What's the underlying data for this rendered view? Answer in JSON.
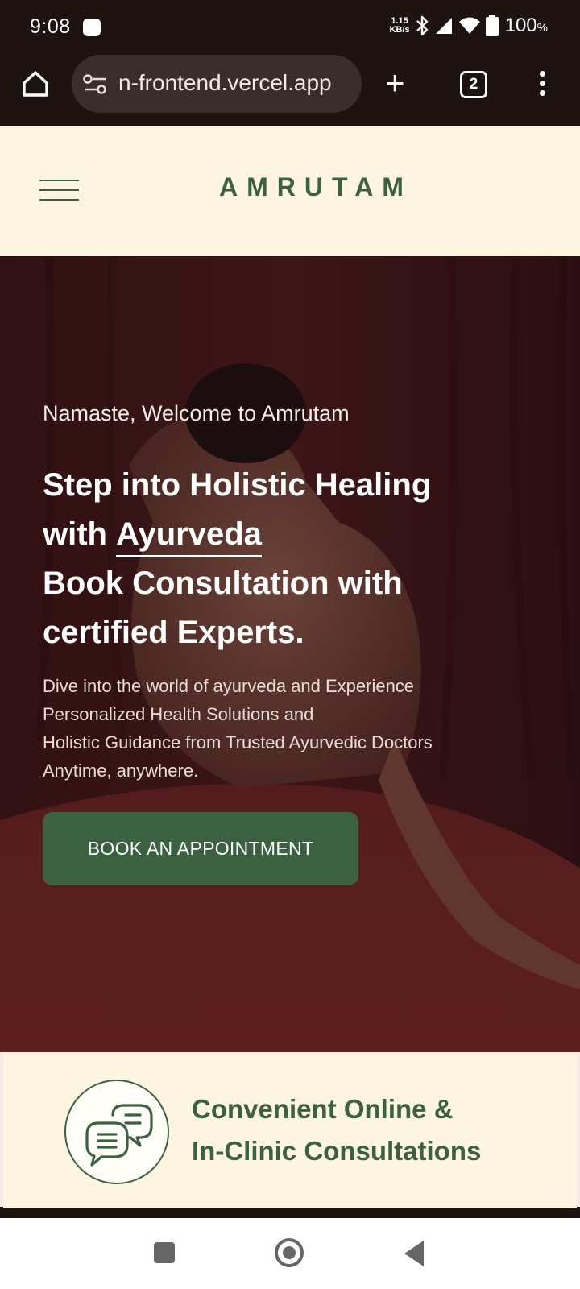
{
  "status_bar": {
    "time": "9:08",
    "net_speed_value": "1.15",
    "net_speed_unit": "KB/s",
    "battery": "100",
    "battery_unit": "%"
  },
  "browser": {
    "url": "n-frontend.vercel.app",
    "tab_count": "2"
  },
  "header": {
    "brand": "AMRUTAM"
  },
  "hero": {
    "kicker": "Namaste, Welcome to Amrutam",
    "title_line1": "Step into Holistic Healing",
    "title_with": "with ",
    "title_highlight": "Ayurveda",
    "title_line3": "Book Consultation with",
    "title_line4": "certified Experts.",
    "desc_line1": "Dive into the world of ayurveda and Experience",
    "desc_line2": "Personalized Health Solutions and",
    "desc_line3": "Holistic Guidance from Trusted Ayurvedic Doctors",
    "desc_line4": "Anytime, anywhere.",
    "cta_label": "BOOK AN APPOINTMENT"
  },
  "feature": {
    "title_line1": "Convenient Online &",
    "title_line2": "In-Clinic Consultations",
    "icon": "chat-bubbles-icon"
  },
  "colors": {
    "brand_green": "#3b6141",
    "cream": "#fdf5e0",
    "hero_red": "#5a1f20"
  }
}
